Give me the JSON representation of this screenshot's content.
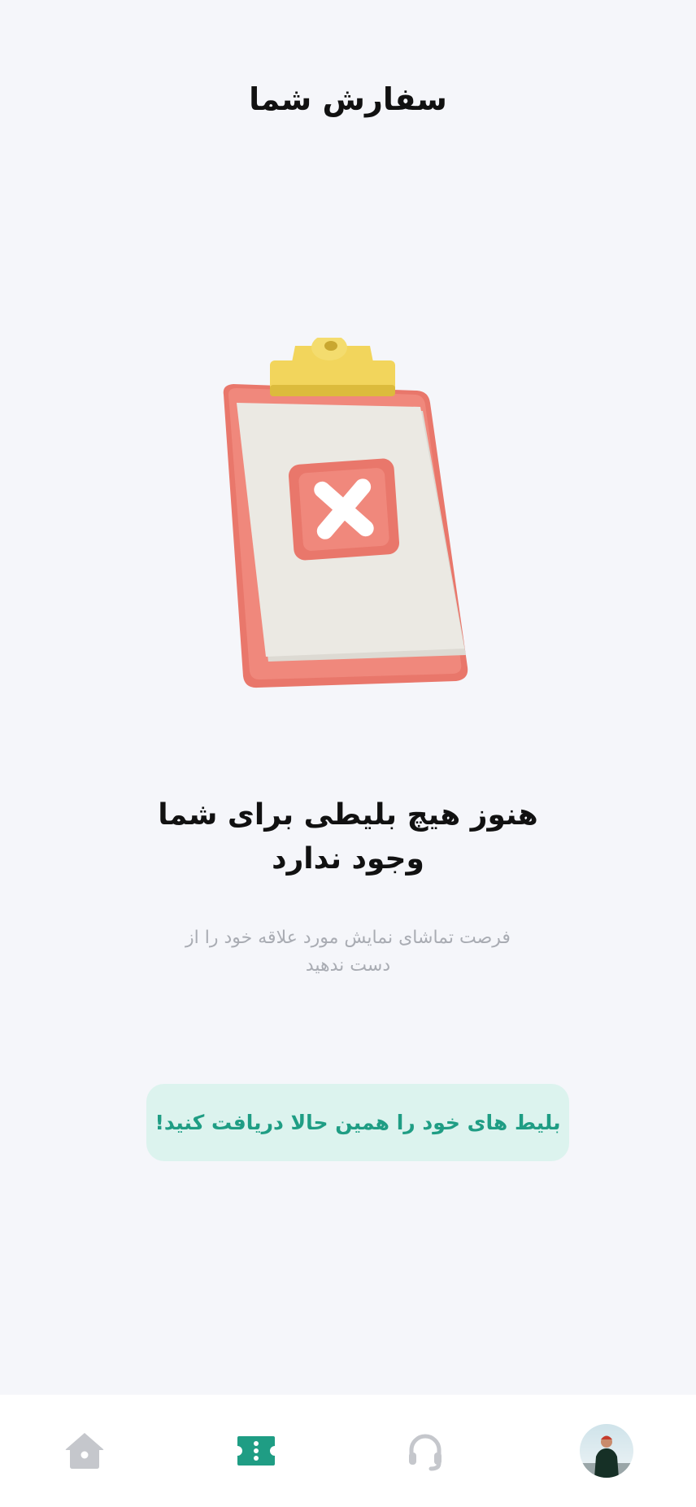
{
  "header": {
    "title": "سفارش شما"
  },
  "empty_state": {
    "heading_line1": "هنوز هیچ بلیطی برای شما",
    "heading_line2": "وجود ندارد",
    "subtitle_line1": "فرصت تماشای نمایش مورد علاقه خود را از",
    "subtitle_line2": "دست ندهید",
    "illustration_icon": "clipboard-x-icon"
  },
  "cta": {
    "label": "بلیط های خود را همین حالا دریافت کنید!"
  },
  "bottom_nav": {
    "items": [
      {
        "name": "profile",
        "icon": "avatar",
        "active": false
      },
      {
        "name": "support",
        "icon": "headset-icon",
        "active": false
      },
      {
        "name": "tickets",
        "icon": "ticket-icon",
        "active": true
      },
      {
        "name": "home",
        "icon": "home-icon",
        "active": false
      }
    ]
  },
  "colors": {
    "accent": "#1f9d84",
    "accent_bg": "#dcf3ee",
    "inactive_icon": "#c5c7cc",
    "background": "#f5f6fa"
  }
}
